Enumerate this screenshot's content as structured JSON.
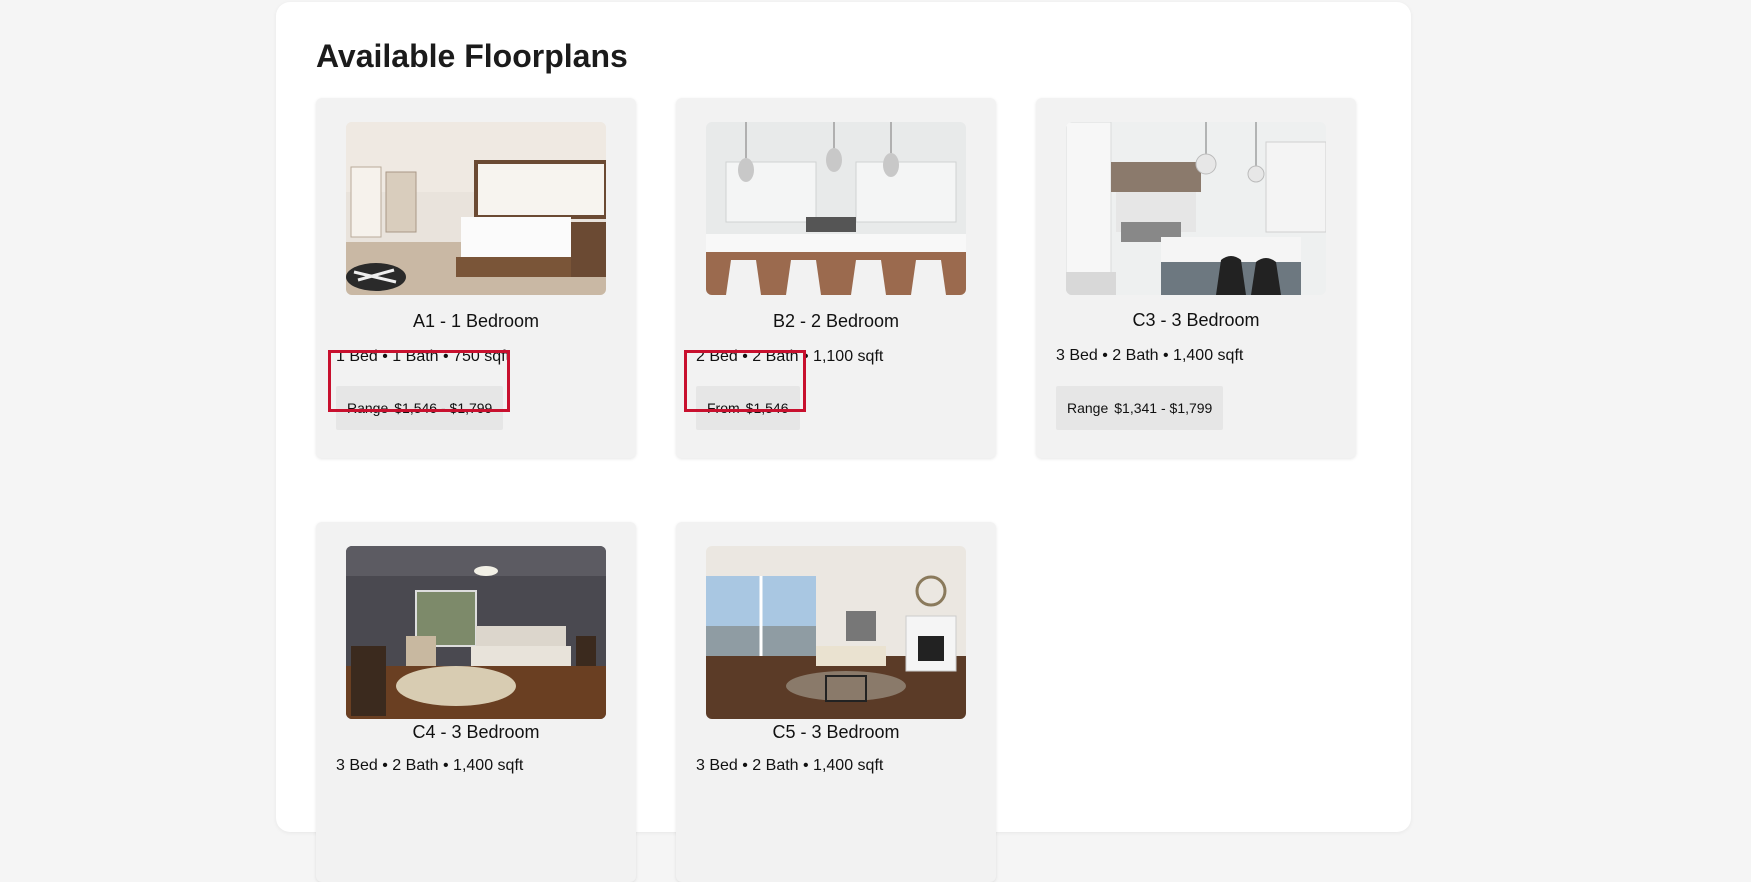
{
  "page": {
    "title": "Available Floorplans"
  },
  "colors": {
    "highlight": "#c8102e",
    "card_bg": "#f2f2f2",
    "price_bg": "#e6e6e6"
  },
  "floorplans": [
    {
      "name": "A1 - 1 Bedroom",
      "specs": "1 Bed • 1 Bath • 750 sqft",
      "price_label": "Range",
      "price_value": "$1,546 - $1,799",
      "photo": "bedroom-photo",
      "highlighted": true
    },
    {
      "name": "B2 - 2 Bedroom",
      "specs": "2 Bed • 2 Bath • 1,100 sqft",
      "price_label": "From",
      "price_value": "$1,546",
      "photo": "kitchen-photo",
      "highlighted": true
    },
    {
      "name": "C3 - 3 Bedroom",
      "specs": "3 Bed • 2 Bath • 1,400 sqft",
      "price_label": "Range",
      "price_value": "$1,341 - $1,799",
      "photo": "kitchen-photo",
      "highlighted": false
    },
    {
      "name": "C4 - 3 Bedroom",
      "specs": "3 Bed • 2 Bath • 1,400 sqft",
      "photo": "bedroom-photo"
    },
    {
      "name": "C5 - 3 Bedroom",
      "specs": "3 Bed • 2 Bath • 1,400 sqft",
      "photo": "living-room-photo"
    }
  ]
}
